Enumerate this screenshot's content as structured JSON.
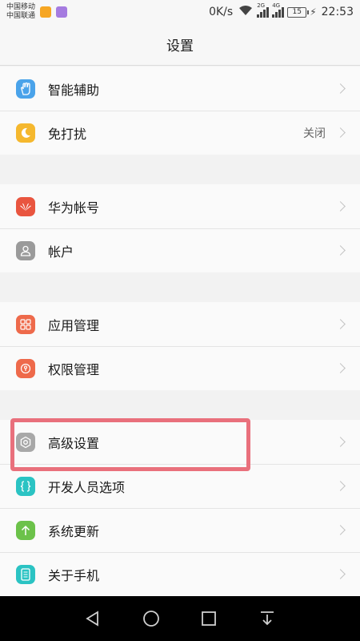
{
  "status_bar": {
    "carrier_1": "中国移动",
    "carrier_2": "中国联通",
    "net_speed": "0K/s",
    "net_type_1": "2G",
    "net_type_2": "4G",
    "battery_level": "15",
    "time": "22:53"
  },
  "header": {
    "title": "设置"
  },
  "groups": [
    {
      "items": [
        {
          "label": "智能辅助",
          "icon": "hand-icon",
          "color": "#4aa3ea"
        },
        {
          "label": "免打扰",
          "value": "关闭",
          "icon": "moon-icon",
          "color": "#f5b82e"
        }
      ]
    },
    {
      "items": [
        {
          "label": "华为帐号",
          "icon": "huawei-icon",
          "color": "#e9553f"
        },
        {
          "label": "帐户",
          "icon": "person-icon",
          "color": "#9a9a9a"
        }
      ]
    },
    {
      "items": [
        {
          "label": "应用管理",
          "icon": "apps-grid-icon",
          "color": "#ee6a4b"
        },
        {
          "label": "权限管理",
          "icon": "permission-icon",
          "color": "#ee6a4b"
        }
      ]
    },
    {
      "items": [
        {
          "label": "高级设置",
          "icon": "gear-icon",
          "color": "#a8a8a8"
        },
        {
          "label": "开发人员选项",
          "icon": "braces-icon",
          "color": "#2bc3c3"
        },
        {
          "label": "系统更新",
          "icon": "arrow-up-icon",
          "color": "#6cc24a"
        },
        {
          "label": "关于手机",
          "icon": "phone-info-icon",
          "color": "#2bc3c3"
        }
      ]
    }
  ],
  "colors": {
    "highlight": "#e9707c"
  }
}
